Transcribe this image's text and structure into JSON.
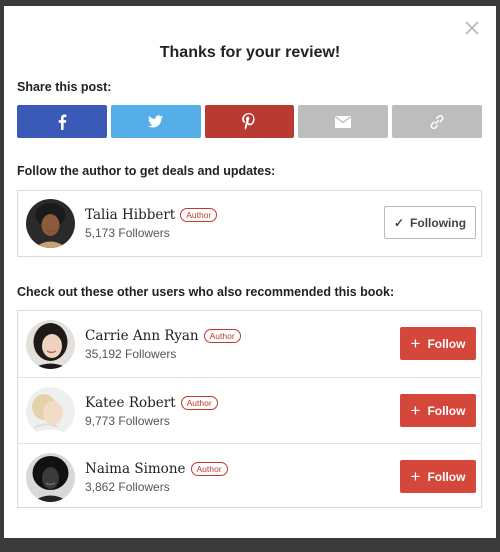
{
  "modal": {
    "title": "Thanks for your review!",
    "close_icon": "close-icon"
  },
  "share": {
    "label": "Share this post:",
    "buttons": [
      {
        "name": "facebook",
        "icon": "facebook-icon",
        "color": "#3b59b6"
      },
      {
        "name": "twitter",
        "icon": "twitter-icon",
        "color": "#55aee8"
      },
      {
        "name": "pinterest",
        "icon": "pinterest-icon",
        "color": "#b83a30"
      },
      {
        "name": "email",
        "icon": "email-icon",
        "color": "#bdbdbd"
      },
      {
        "name": "link",
        "icon": "link-icon",
        "color": "#bdbdbd"
      }
    ]
  },
  "author_section": {
    "label": "Follow the author to get deals and updates:",
    "author": {
      "name": "Talia Hibbert",
      "badge": "Author",
      "followers": "5,173 Followers",
      "button_label": "Following",
      "button_icon": "check-icon"
    }
  },
  "recommenders": {
    "label": "Check out these other users who also recommended this book:",
    "users": [
      {
        "name": "Carrie Ann Ryan",
        "badge": "Author",
        "followers": "35,192 Followers",
        "button_label": "Follow"
      },
      {
        "name": "Katee Robert",
        "badge": "Author",
        "followers": "9,773 Followers",
        "button_label": "Follow"
      },
      {
        "name": "Naima Simone",
        "badge": "Author",
        "followers": "3,862 Followers",
        "button_label": "Follow"
      }
    ]
  },
  "colors": {
    "follow_button": "#d4473a",
    "badge": "#c0392b"
  }
}
